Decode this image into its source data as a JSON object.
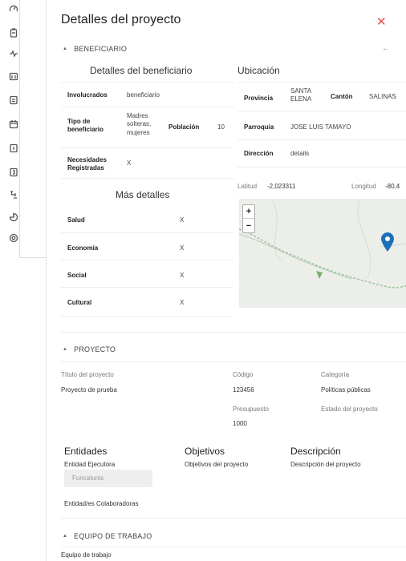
{
  "rail": {
    "icons": [
      "gauge-icon",
      "clipboard-icon",
      "pulse-icon",
      "folder-icon",
      "document-icon",
      "calendar-icon",
      "list-icon",
      "user-badge-icon",
      "sitemap-icon",
      "pie-chart-icon",
      "settings-icon"
    ]
  },
  "header": {
    "title": "Detalles del proyecto",
    "close_glyph": "✕"
  },
  "beneficiario": {
    "section_label": "BENEFICIARIO",
    "back_glyph": "←",
    "detalles_title": "Detalles del beneficiario",
    "involucrados_label": "Involucrados",
    "involucrados_value": "beneficiario",
    "tipo_label": "Tipo de beneficiario",
    "tipo_value": "Madres solteras, mujeres",
    "poblacion_label": "Población",
    "poblacion_value": "10",
    "necesidades_label": "Necesidades Registradas",
    "necesidades_value": "X",
    "mas_title": "Más detalles",
    "mas_rows": [
      {
        "label": "Salud",
        "value": "X"
      },
      {
        "label": "Economía",
        "value": "X"
      },
      {
        "label": "Social",
        "value": "X"
      },
      {
        "label": "Cultural",
        "value": "X"
      }
    ]
  },
  "ubicacion": {
    "title": "Ubicación",
    "provincia_label": "Provincia",
    "provincia_value": "SANTA ELENA",
    "canton_label": "Cantón",
    "canton_value": "SALINAS",
    "parroquia_label": "Parroquia",
    "parroquia_value": "JOSE LUIS TAMAYO",
    "direccion_label": "Dirección",
    "direccion_value": "details",
    "latitud_label": "Latitud",
    "latitud_value": "-2,023311",
    "longitud_label": "Longitud",
    "longitud_value": "-80,4",
    "zoom_in": "+",
    "zoom_out": "−"
  },
  "proyecto": {
    "section_label": "PROYECTO",
    "titulo_label": "Título del proyecto",
    "titulo_value": "Proyecto de prueba",
    "codigo_label": "Código",
    "codigo_value": "123456",
    "categoria_label": "Categoría",
    "categoria_value": "Políticas públicas",
    "presupuesto_label": "Presupuesto",
    "presupuesto_value": "1000",
    "estado_label": "Estado del proyecto",
    "entidades_title": "Entidades",
    "entidad_ejecutora_label": "Entidad Ejecutora",
    "entidad_ejecutora_value": "Funcatunis",
    "entidades_colab_label": "Entidad/es Colaboradoras",
    "objetivos_title": "Objetivos",
    "objetivos_value": "Objetivos del proyecto",
    "descripcion_title": "Descripción",
    "descripcion_value": "Descripción del proyecto"
  },
  "equipo": {
    "section_label": "EQUIPO DE TRABAJO",
    "equipo_value": "Equipo de trabajo"
  },
  "colors": {
    "accent_close": "#e05050",
    "pin": "#1e6fb8",
    "river": "#9cc2a0"
  }
}
